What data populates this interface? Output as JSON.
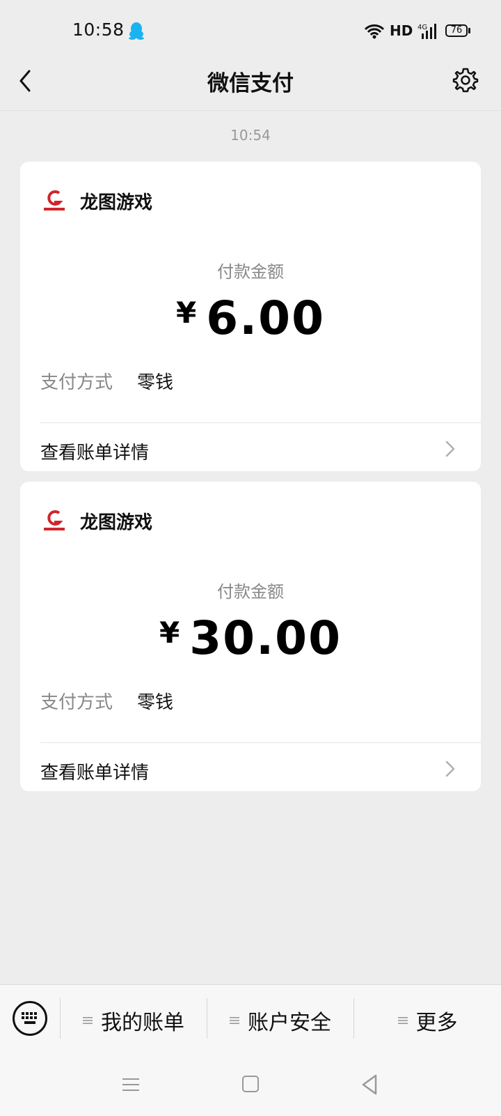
{
  "status_bar": {
    "time": "10:58",
    "network": "HD",
    "battery": "76",
    "icons": [
      "qq-icon",
      "wifi-icon",
      "signal-4g-icon",
      "battery-icon"
    ]
  },
  "header": {
    "title": "微信支付",
    "icons": [
      "back-icon",
      "gear-icon"
    ]
  },
  "message_time": "10:54",
  "cards": [
    {
      "merchant": "龙图游戏",
      "amount_label": "付款金额",
      "currency": "¥",
      "amount": "6.00",
      "method_label": "支付方式",
      "method_value": "零钱",
      "detail_label": "查看账单详情"
    },
    {
      "merchant": "龙图游戏",
      "amount_label": "付款金额",
      "currency": "¥",
      "amount": "30.00",
      "method_label": "支付方式",
      "method_value": "零钱",
      "detail_label": "查看账单详情"
    }
  ],
  "bottom_menu": {
    "items": [
      "我的账单",
      "账户安全",
      "更多"
    ]
  },
  "colors": {
    "background": "#ededed",
    "card": "#ffffff",
    "logo_red": "#d0252b",
    "qq_blue": "#19b4f0"
  }
}
